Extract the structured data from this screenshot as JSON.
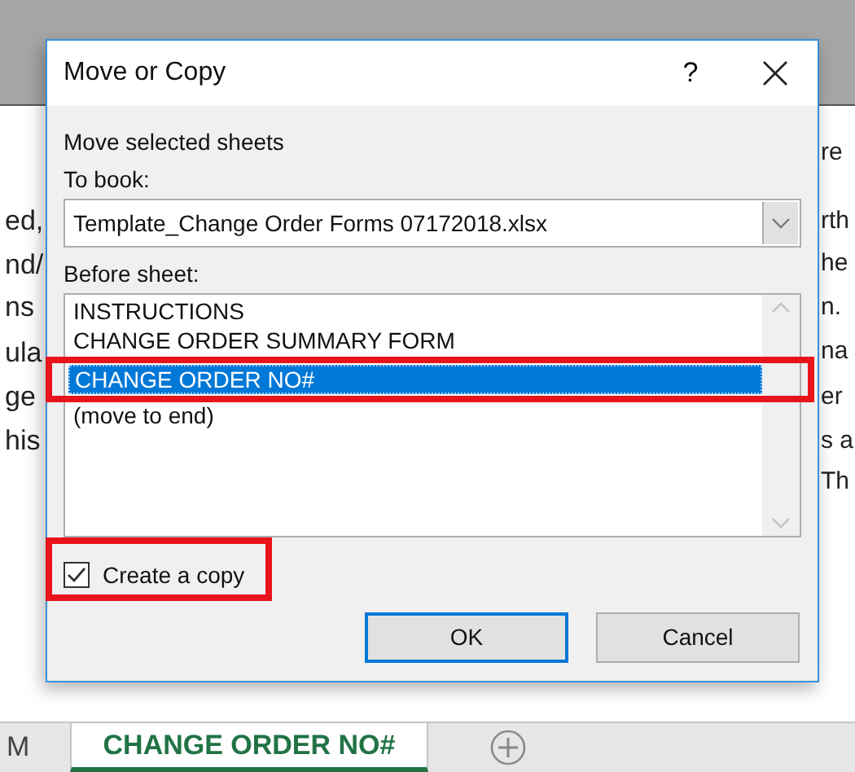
{
  "spreadsheet": {
    "fragments": [
      {
        "right": "re"
      },
      {
        "left": "ed,",
        "right": "rth"
      },
      {
        "left": "nd/",
        "right": "he"
      },
      {
        "left": "ns",
        "right": "n."
      },
      {
        "left": "ula",
        "right": "na"
      },
      {
        "left": "ge",
        "right": "er"
      },
      {
        "left": "his",
        "right": "s a"
      },
      {
        "right": "Th"
      }
    ],
    "sheet_tabs": [
      {
        "label": "M",
        "selected": false
      },
      {
        "label": "CHANGE ORDER NO#",
        "selected": true
      }
    ]
  },
  "dialog": {
    "title": "Move or Copy",
    "help": "?",
    "intro": "Move selected sheets",
    "to_book_label": "To book:",
    "to_book_value": "Template_Change Order Forms 07172018.xlsx",
    "before_sheet_label": "Before sheet:",
    "sheets": [
      {
        "label": "INSTRUCTIONS",
        "selected": false
      },
      {
        "label": "CHANGE ORDER SUMMARY FORM",
        "selected": false
      },
      {
        "label": "CHANGE ORDER NO#",
        "selected": true
      },
      {
        "label": "(move to end)",
        "selected": false
      }
    ],
    "create_copy": {
      "label": "Create a copy",
      "checked": true
    },
    "buttons": [
      {
        "label": "OK",
        "default": true
      },
      {
        "label": "Cancel",
        "default": false
      }
    ]
  }
}
